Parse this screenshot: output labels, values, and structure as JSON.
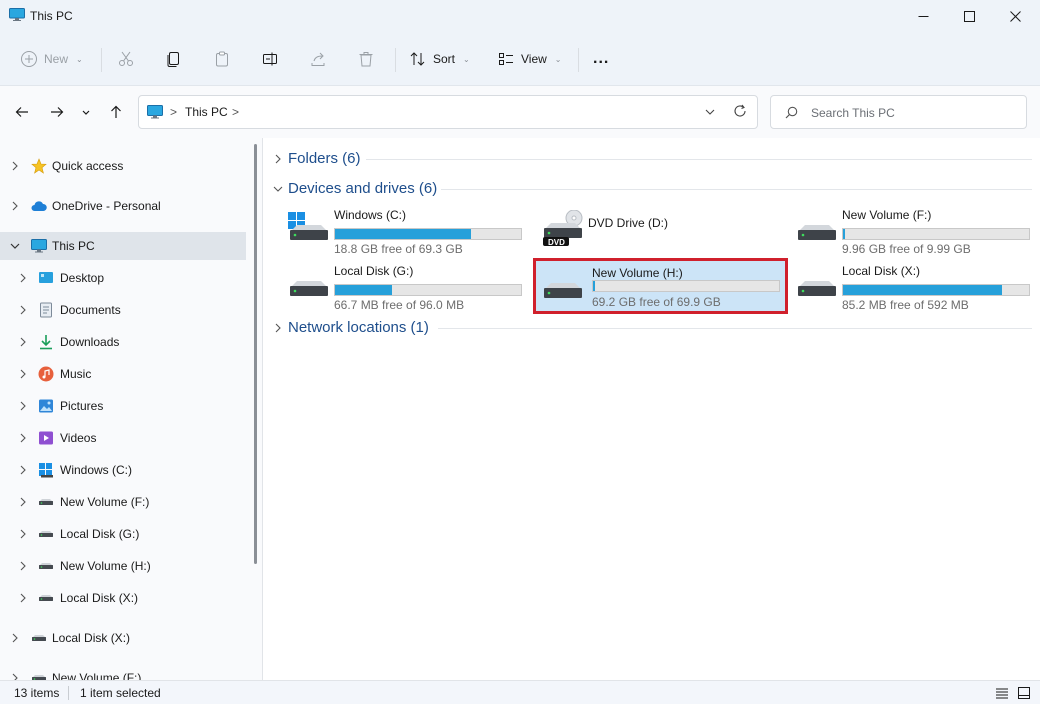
{
  "window": {
    "title": "This PC"
  },
  "toolbar": {
    "new_label": "New",
    "sort_label": "Sort",
    "view_label": "View",
    "more_label": "..."
  },
  "address": {
    "crumb": "This PC",
    "separator": ">",
    "search_placeholder": "Search This PC"
  },
  "sidebar": {
    "items": [
      {
        "label": "Quick access",
        "icon": "star-icon",
        "level": 0
      },
      {
        "label": "OneDrive - Personal",
        "icon": "cloud-icon",
        "level": 0
      },
      {
        "label": "This PC",
        "icon": "monitor-icon",
        "level": 0,
        "expanded": true,
        "selected": true
      },
      {
        "label": "Desktop",
        "icon": "desktop-folder-icon",
        "level": 1
      },
      {
        "label": "Documents",
        "icon": "documents-icon",
        "level": 1
      },
      {
        "label": "Downloads",
        "icon": "download-icon",
        "level": 1
      },
      {
        "label": "Music",
        "icon": "music-icon",
        "level": 1
      },
      {
        "label": "Pictures",
        "icon": "pictures-icon",
        "level": 1
      },
      {
        "label": "Videos",
        "icon": "videos-icon",
        "level": 1
      },
      {
        "label": "Windows (C:)",
        "icon": "windows-drive-icon",
        "level": 1
      },
      {
        "label": "New Volume (F:)",
        "icon": "drive-icon",
        "level": 1
      },
      {
        "label": "Local Disk (G:)",
        "icon": "drive-icon",
        "level": 1
      },
      {
        "label": "New Volume (H:)",
        "icon": "drive-icon",
        "level": 1
      },
      {
        "label": "Local Disk (X:)",
        "icon": "drive-icon",
        "level": 1
      },
      {
        "label": "Local Disk (X:)",
        "icon": "drive-icon",
        "level": 0
      },
      {
        "label": "New Volume (F:)",
        "icon": "drive-icon",
        "level": 0
      }
    ]
  },
  "groups": {
    "folders": "Folders (6)",
    "devices": "Devices and drives (6)",
    "network": "Network locations (1)"
  },
  "drives": [
    {
      "name": "Windows (C:)",
      "free": "18.8 GB free of 69.3 GB",
      "used_fraction": 0.73,
      "kind": "windows",
      "selected": false,
      "has_bar": true
    },
    {
      "name": "DVD Drive (D:)",
      "free": "",
      "used_fraction": 0,
      "kind": "dvd",
      "selected": false,
      "has_bar": false,
      "badge": "DVD"
    },
    {
      "name": "New Volume (F:)",
      "free": "9.96 GB free of 9.99 GB",
      "used_fraction": 0.003,
      "kind": "disk",
      "selected": false,
      "has_bar": true
    },
    {
      "name": "Local Disk (G:)",
      "free": "66.7 MB free of 96.0 MB",
      "used_fraction": 0.305,
      "kind": "disk",
      "selected": false,
      "has_bar": true
    },
    {
      "name": "New Volume (H:)",
      "free": "69.2 GB free of 69.9 GB",
      "used_fraction": 0.01,
      "kind": "disk",
      "selected": true,
      "has_bar": true
    },
    {
      "name": "Local Disk (X:)",
      "free": "85.2 MB free of 592 MB",
      "used_fraction": 0.856,
      "kind": "disk",
      "selected": false,
      "has_bar": true
    }
  ],
  "status": {
    "items_count": "13 items",
    "selection": "1 item selected"
  },
  "colors": {
    "accent": "#26a0da",
    "group_title": "#1e4e8c",
    "selection_bg": "#cce4f7",
    "highlight_border": "#d0202c"
  }
}
